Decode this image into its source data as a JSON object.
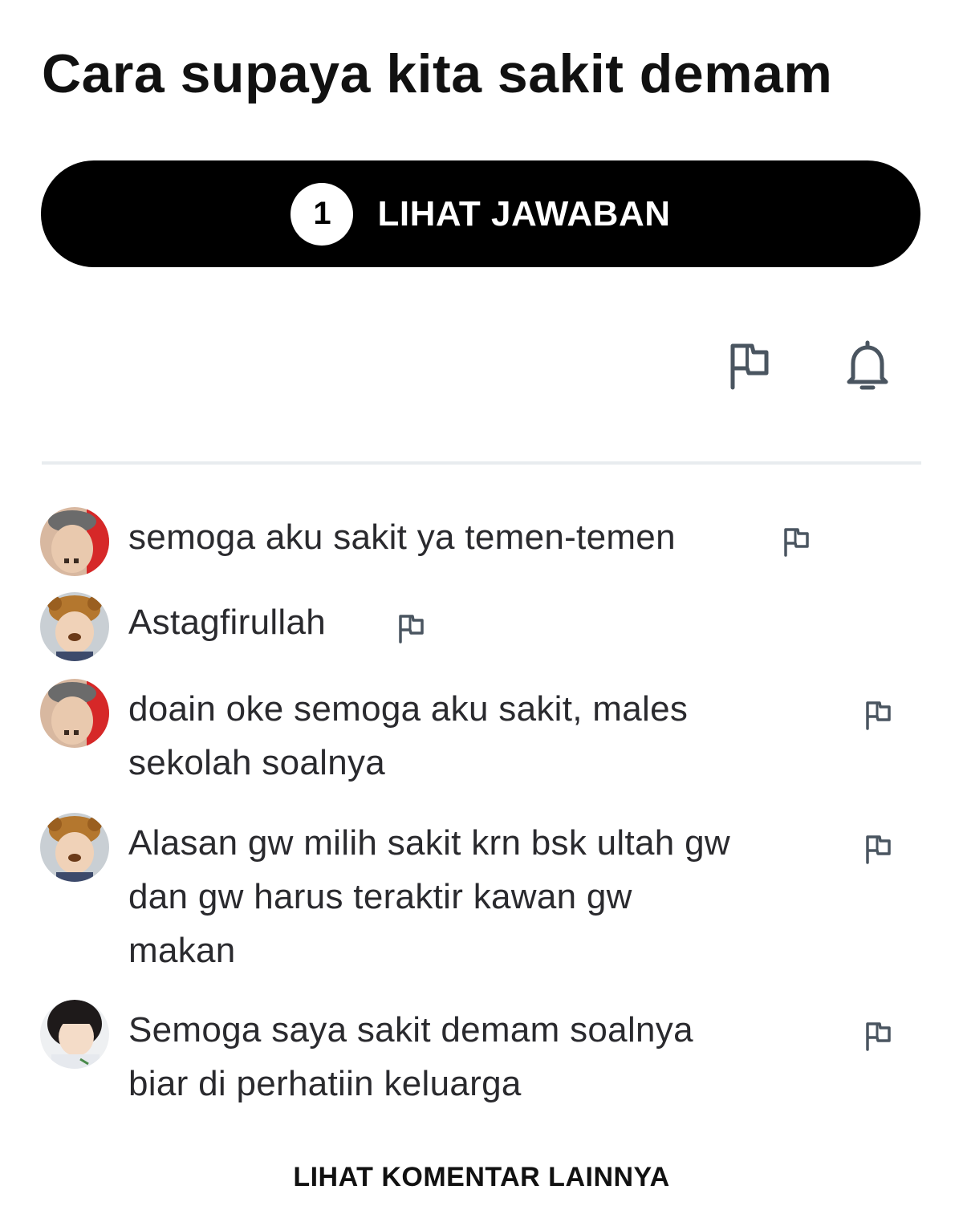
{
  "question": {
    "title": "Cara supaya kita sakit demam"
  },
  "answer_button": {
    "count": "1",
    "label": "LIHAT JAWABAN"
  },
  "actions": {
    "report_icon": "flag-icon",
    "notify_icon": "bell-icon"
  },
  "comments": [
    {
      "avatar": "user-avatar-1",
      "lines": [
        "semoga aku sakit ya temen-temen"
      ]
    },
    {
      "avatar": "user-avatar-2",
      "lines": [
        "Astagfirullah"
      ]
    },
    {
      "avatar": "user-avatar-1",
      "lines": [
        "doain oke semoga aku sakit, males",
        "sekolah soalnya"
      ]
    },
    {
      "avatar": "user-avatar-2",
      "lines": [
        "Alasan gw milih sakit krn bsk ultah gw",
        "dan gw harus teraktir kawan gw",
        "makan"
      ]
    },
    {
      "avatar": "user-avatar-3",
      "lines": [
        "Semoga saya sakit demam soalnya",
        "biar di perhatiin keluarga"
      ]
    }
  ],
  "more_comments_label": "LIHAT KOMENTAR LAINNYA",
  "colors": {
    "button_bg": "#000000",
    "icon": "#4a5560",
    "divider": "#e8ecef"
  }
}
